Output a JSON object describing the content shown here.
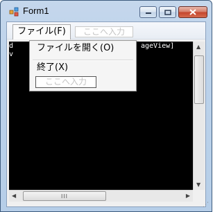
{
  "window": {
    "title": "Form1"
  },
  "caption_buttons": {
    "minimize": "minimize-icon",
    "maximize": "maximize-icon",
    "close": "close-icon"
  },
  "menubar": {
    "file_label": "ファイル(F)",
    "new_item_placeholder": "ここへ入力"
  },
  "file_menu": {
    "items": [
      {
        "label": "ファイルを開く(O)"
      },
      {
        "label": "終了(X)"
      }
    ],
    "new_item_placeholder": "ここへ入力"
  },
  "console": {
    "line1": "d",
    "line1_right": "ageView]",
    "line2": "v"
  },
  "scrollbar": {
    "thumb_grip": "III"
  }
}
